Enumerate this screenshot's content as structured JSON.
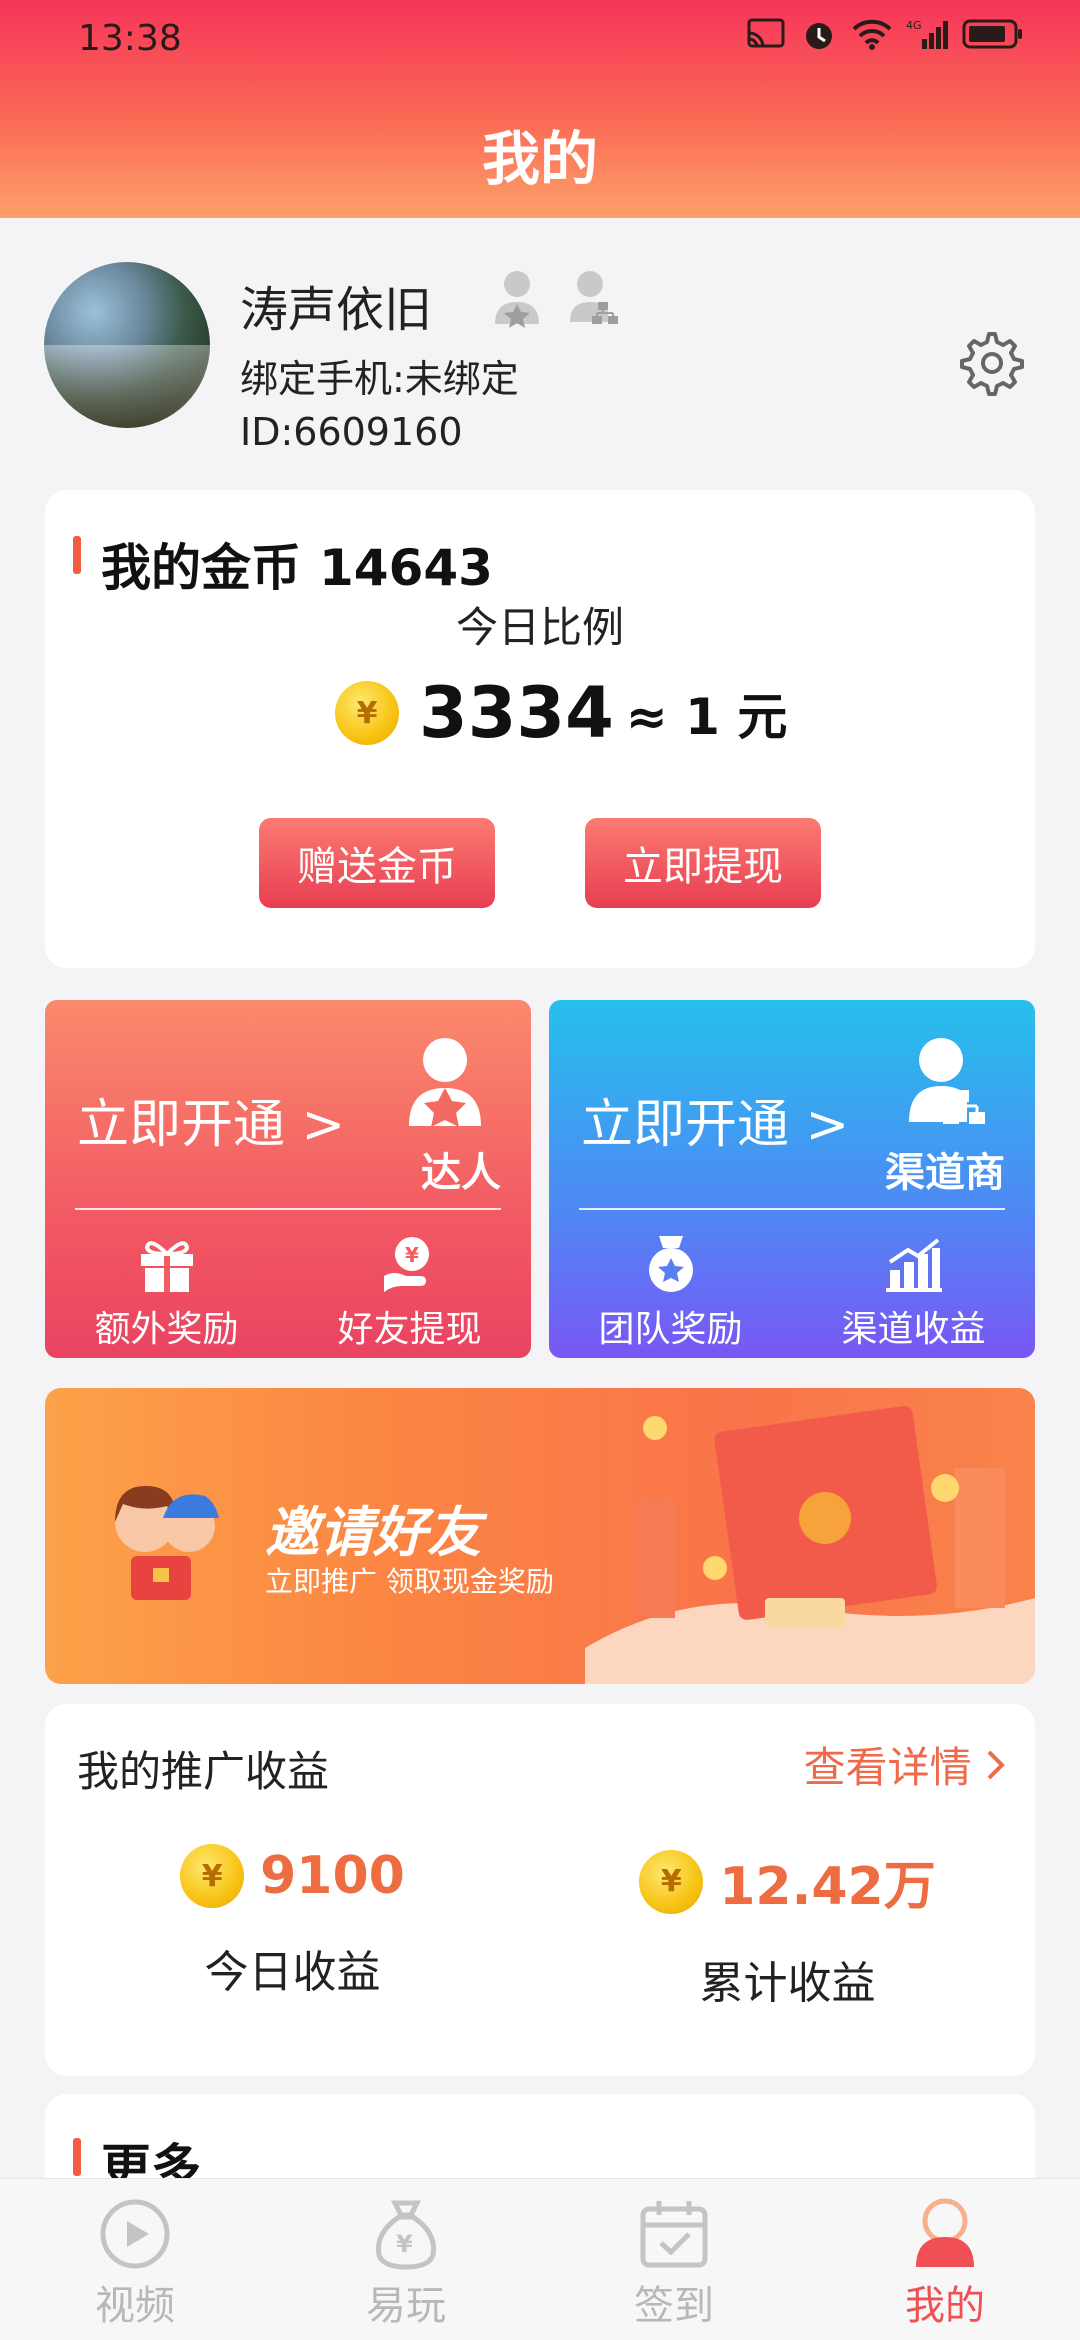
{
  "status_bar": {
    "time": "13:38"
  },
  "header": {
    "title": "我的"
  },
  "profile": {
    "name": "涛声依旧",
    "phone": "绑定手机:未绑定",
    "id": "ID:6609160"
  },
  "coins": {
    "title": "我的金币",
    "amount": "14643",
    "ratio_label": "今日比例",
    "ratio_value": "3334",
    "ratio_eq": "≈ 1 元",
    "coin_symbol": "¥",
    "gift_button": "赠送金币",
    "withdraw_button": "立即提现"
  },
  "tiles": [
    {
      "open": "立即开通 >",
      "role": "达人",
      "icon": "vip-user-icon",
      "subs": [
        {
          "label": "额外奖励",
          "icon": "gift-icon"
        },
        {
          "label": "好友提现",
          "icon": "cash-hand-icon"
        }
      ]
    },
    {
      "open": "立即开通 >",
      "role": "渠道商",
      "icon": "org-user-icon",
      "subs": [
        {
          "label": "团队奖励",
          "icon": "medal-icon"
        },
        {
          "label": "渠道收益",
          "icon": "bar-growth-icon"
        }
      ]
    }
  ],
  "banner": {
    "title": "邀请好友",
    "subtitle": "立即推广  领取现金奖励"
  },
  "earnings": {
    "title": "我的推广收益",
    "link": "查看详情",
    "today_value": "9100",
    "today_label": "今日收益",
    "total_value": "12.42万",
    "total_label": "累计收益"
  },
  "more": {
    "title": "更多"
  },
  "nav": [
    {
      "label": "视频",
      "icon": "play-circle-icon"
    },
    {
      "label": "易玩",
      "icon": "money-bag-icon"
    },
    {
      "label": "签到",
      "icon": "calendar-check-icon"
    },
    {
      "label": "我的",
      "icon": "user-icon"
    }
  ],
  "colors": {
    "accent": "#ef4f55",
    "orange": "#ee6c42",
    "blue": "#4f87f4"
  }
}
